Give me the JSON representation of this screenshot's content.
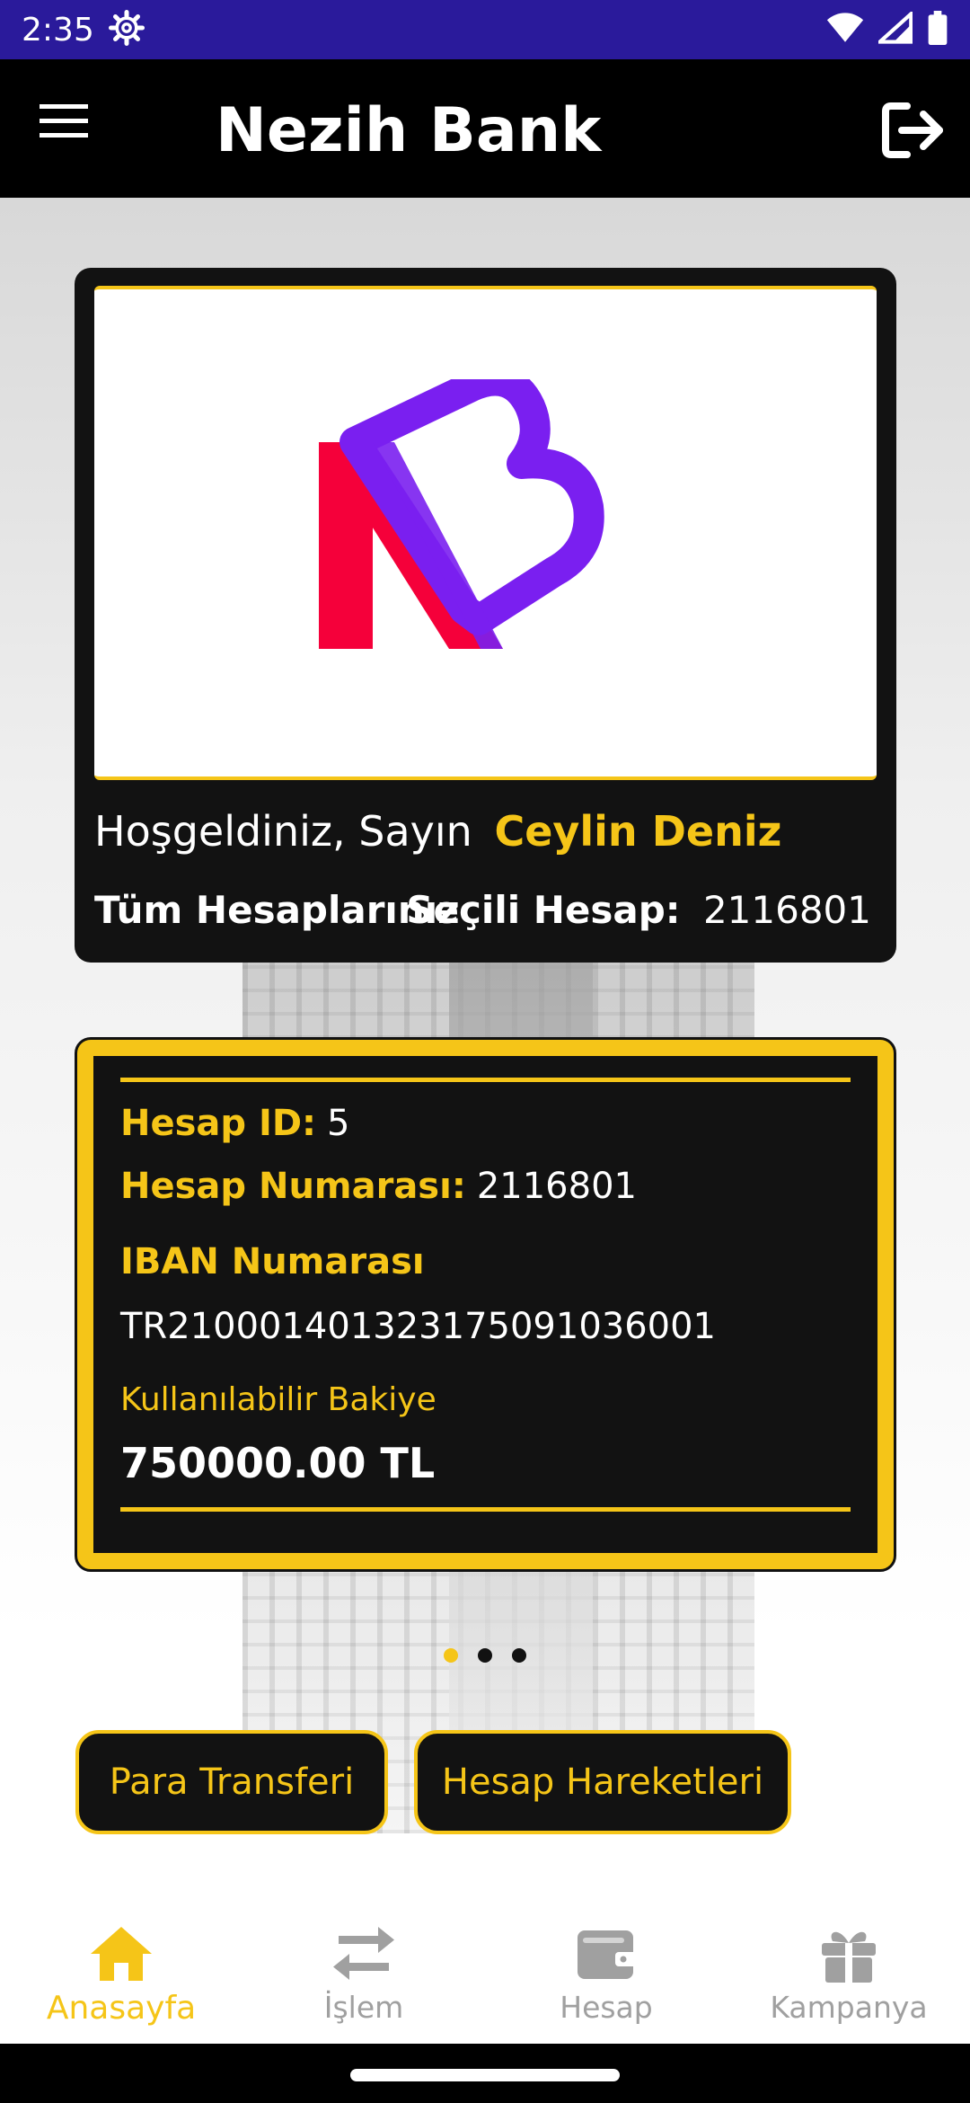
{
  "status_bar": {
    "time": "2:35",
    "icons": [
      "settings-icon",
      "wifi-icon",
      "signal-icon",
      "battery-icon"
    ]
  },
  "app_bar": {
    "title": "Nezih Bank",
    "menu_icon": "menu-icon",
    "logout_icon": "logout-icon"
  },
  "welcome": {
    "greeting": "Hoşgeldiniz, Sayın",
    "name": "Ceylin Deniz",
    "all_accounts_label": "Tüm Hesaplarınız",
    "selected_account_label": "Seçili Hesap:",
    "selected_account_value": "2116801"
  },
  "account": {
    "id_label": "Hesap ID:",
    "id_value": "5",
    "number_label": "Hesap Numarası:",
    "number_value": "2116801",
    "iban_label": "IBAN Numarası",
    "iban_value": "TR210001401323175091036001",
    "balance_label": "Kullanılabilir Bakiye",
    "balance_value": "750000.00 TL"
  },
  "pager": {
    "count": 3,
    "active_index": 0
  },
  "actions": {
    "transfer_label": "Para Transferi",
    "history_label": "Hesap Hareketleri"
  },
  "bottom_nav": {
    "items": [
      {
        "label": "Anasayfa",
        "icon": "home-icon",
        "active": true
      },
      {
        "label": "İşlem",
        "icon": "transfer-arrows-icon",
        "active": false
      },
      {
        "label": "Hesap",
        "icon": "wallet-icon",
        "active": false
      },
      {
        "label": "Kampanya",
        "icon": "gift-icon",
        "active": false
      }
    ]
  },
  "colors": {
    "accent": "#f5c518",
    "status_bar": "#2a1a9b",
    "app_bar": "#000000",
    "card": "#121212",
    "logo_red": "#f5003a",
    "logo_purple": "#7a1ff0",
    "nav_inactive": "#a0a0a0"
  }
}
